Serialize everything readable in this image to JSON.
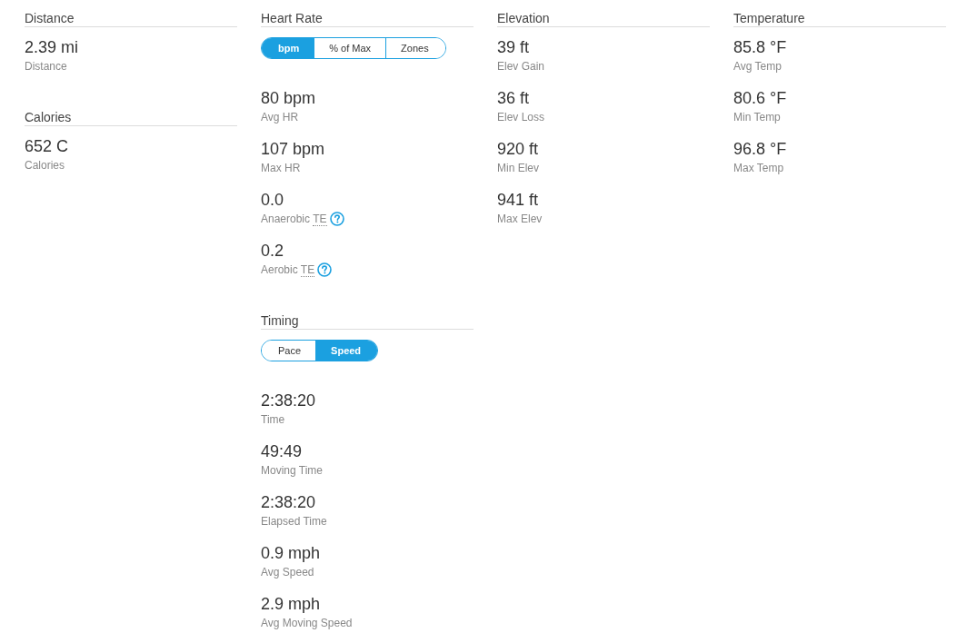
{
  "columns": [
    {
      "sections": [
        {
          "title": "Distance",
          "stats": [
            {
              "value": "2.39 mi",
              "label": "Distance"
            }
          ]
        },
        {
          "title": "Calories",
          "stats": [
            {
              "value": "652 C",
              "label": "Calories"
            }
          ]
        }
      ]
    },
    {
      "sections": [
        {
          "title": "Heart Rate",
          "toggle": [
            {
              "label": "bpm",
              "selected": true
            },
            {
              "label": "% of Max",
              "selected": false
            },
            {
              "label": "Zones",
              "selected": false
            }
          ],
          "stats": [
            {
              "value": "80 bpm",
              "label": "Avg HR"
            },
            {
              "value": "107 bpm",
              "label": "Max HR"
            },
            {
              "value": "0.0",
              "label": "Anaerobic",
              "abbr": "TE",
              "help": true
            },
            {
              "value": "0.2",
              "label": "Aerobic",
              "abbr": "TE",
              "help": true
            }
          ]
        },
        {
          "title": "Timing",
          "toggle": [
            {
              "label": "Pace",
              "selected": false
            },
            {
              "label": "Speed",
              "selected": true
            }
          ],
          "stats": [
            {
              "value": "2:38:20",
              "label": "Time"
            },
            {
              "value": "49:49",
              "label": "Moving Time"
            },
            {
              "value": "2:38:20",
              "label": "Elapsed Time"
            },
            {
              "value": "0.9 mph",
              "label": "Avg Speed"
            },
            {
              "value": "2.9 mph",
              "label": "Avg Moving Speed"
            }
          ]
        }
      ]
    },
    {
      "sections": [
        {
          "title": "Elevation",
          "stats": [
            {
              "value": "39 ft",
              "label": "Elev Gain"
            },
            {
              "value": "36 ft",
              "label": "Elev Loss"
            },
            {
              "value": "920 ft",
              "label": "Min Elev"
            },
            {
              "value": "941 ft",
              "label": "Max Elev"
            }
          ]
        }
      ]
    },
    {
      "sections": [
        {
          "title": "Temperature",
          "stats": [
            {
              "value": "85.8 °F",
              "label": "Avg Temp"
            },
            {
              "value": "80.6 °F",
              "label": "Min Temp"
            },
            {
              "value": "96.8 °F",
              "label": "Max Temp"
            }
          ]
        }
      ]
    }
  ]
}
